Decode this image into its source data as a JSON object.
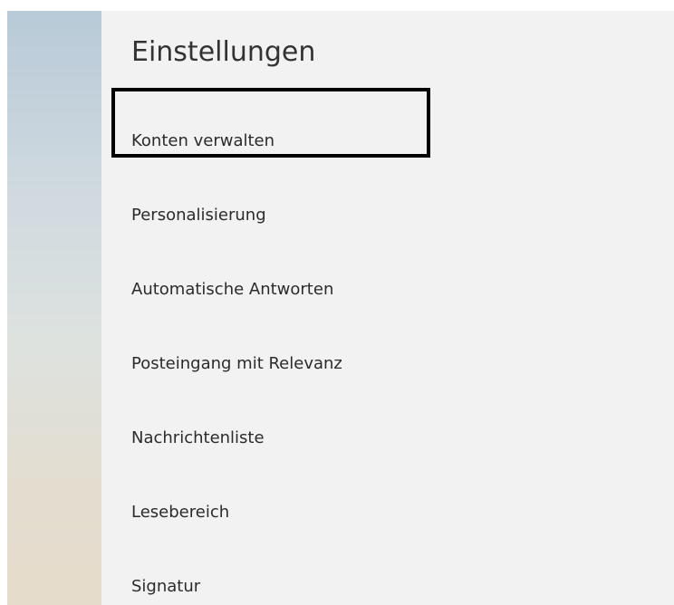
{
  "settings": {
    "title": "Einstellungen",
    "items": [
      {
        "label": "Konten verwalten"
      },
      {
        "label": "Personalisierung"
      },
      {
        "label": "Automatische Antworten"
      },
      {
        "label": "Posteingang mit Relevanz"
      },
      {
        "label": "Nachrichtenliste"
      },
      {
        "label": "Lesebereich"
      },
      {
        "label": "Signatur"
      }
    ]
  }
}
